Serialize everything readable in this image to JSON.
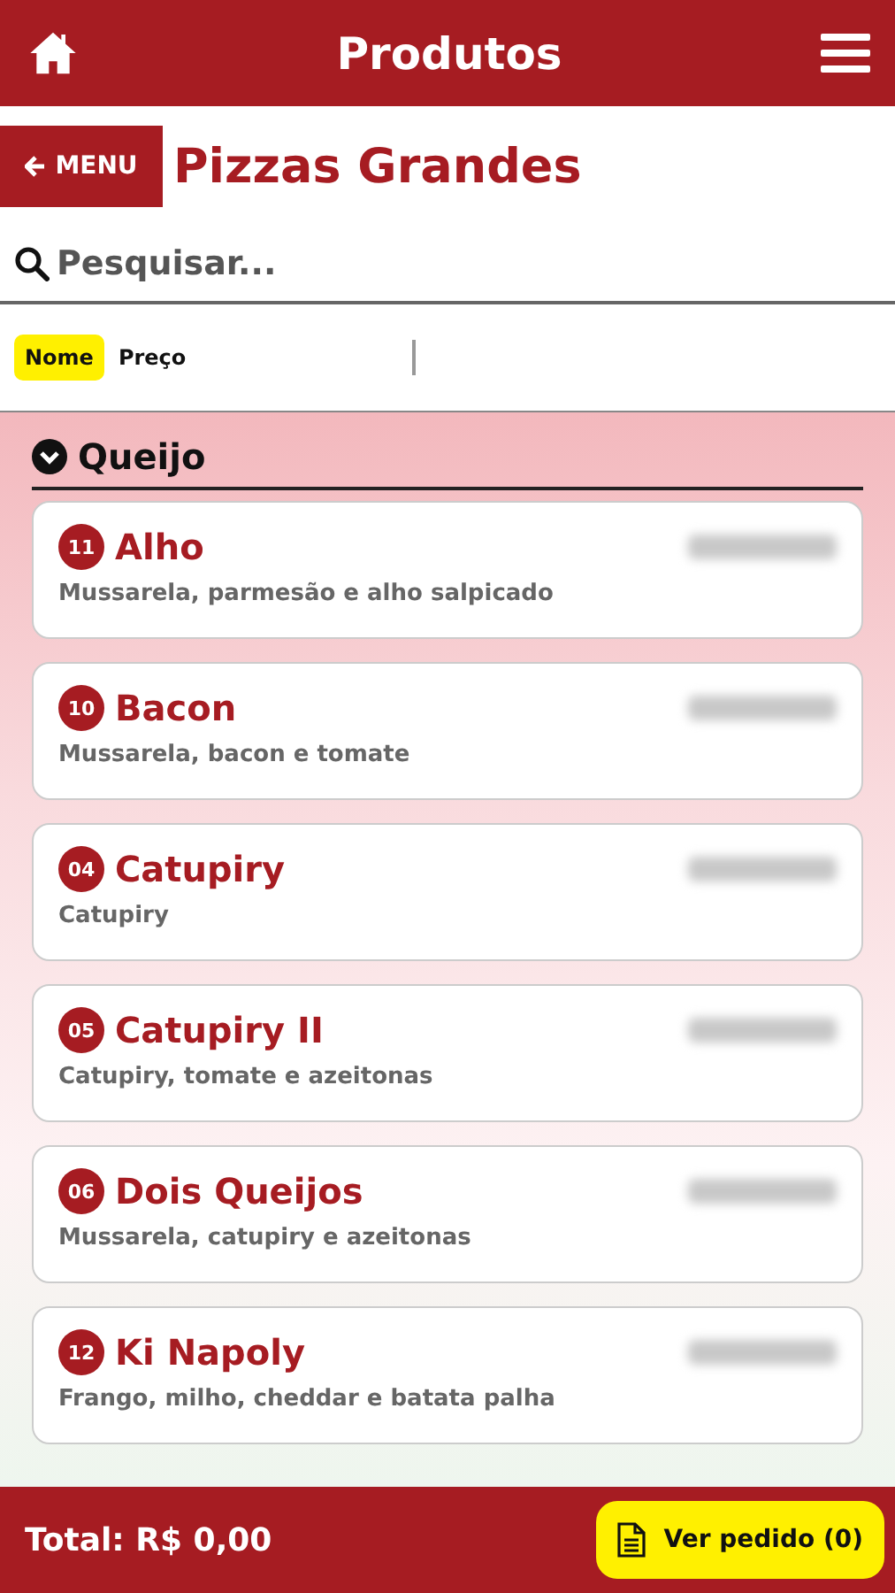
{
  "header": {
    "title": "Produtos"
  },
  "category": {
    "back_label": "MENU",
    "title": "Pizzas Grandes"
  },
  "search": {
    "placeholder": "Pesquisar..."
  },
  "sort_options": [
    {
      "label": "Nome",
      "selected": true
    },
    {
      "label": "Preço",
      "selected": false
    }
  ],
  "section": {
    "title": "Queijo",
    "expanded": true
  },
  "products": [
    {
      "number": "11",
      "name": "Alho",
      "description": "Mussarela, parmesão e alho salpicado"
    },
    {
      "number": "10",
      "name": "Bacon",
      "description": "Mussarela, bacon e tomate"
    },
    {
      "number": "04",
      "name": "Catupiry",
      "description": "Catupiry"
    },
    {
      "number": "05",
      "name": "Catupiry II",
      "description": "Catupiry, tomate e azeitonas"
    },
    {
      "number": "06",
      "name": "Dois Queijos",
      "description": "Mussarela, catupiry e azeitonas"
    },
    {
      "number": "12",
      "name": "Ki Napoly",
      "description": "Frango, milho, cheddar e batata palha"
    }
  ],
  "footer": {
    "total": "Total: R$ 0,00",
    "order_button": "Ver pedido (0)"
  }
}
